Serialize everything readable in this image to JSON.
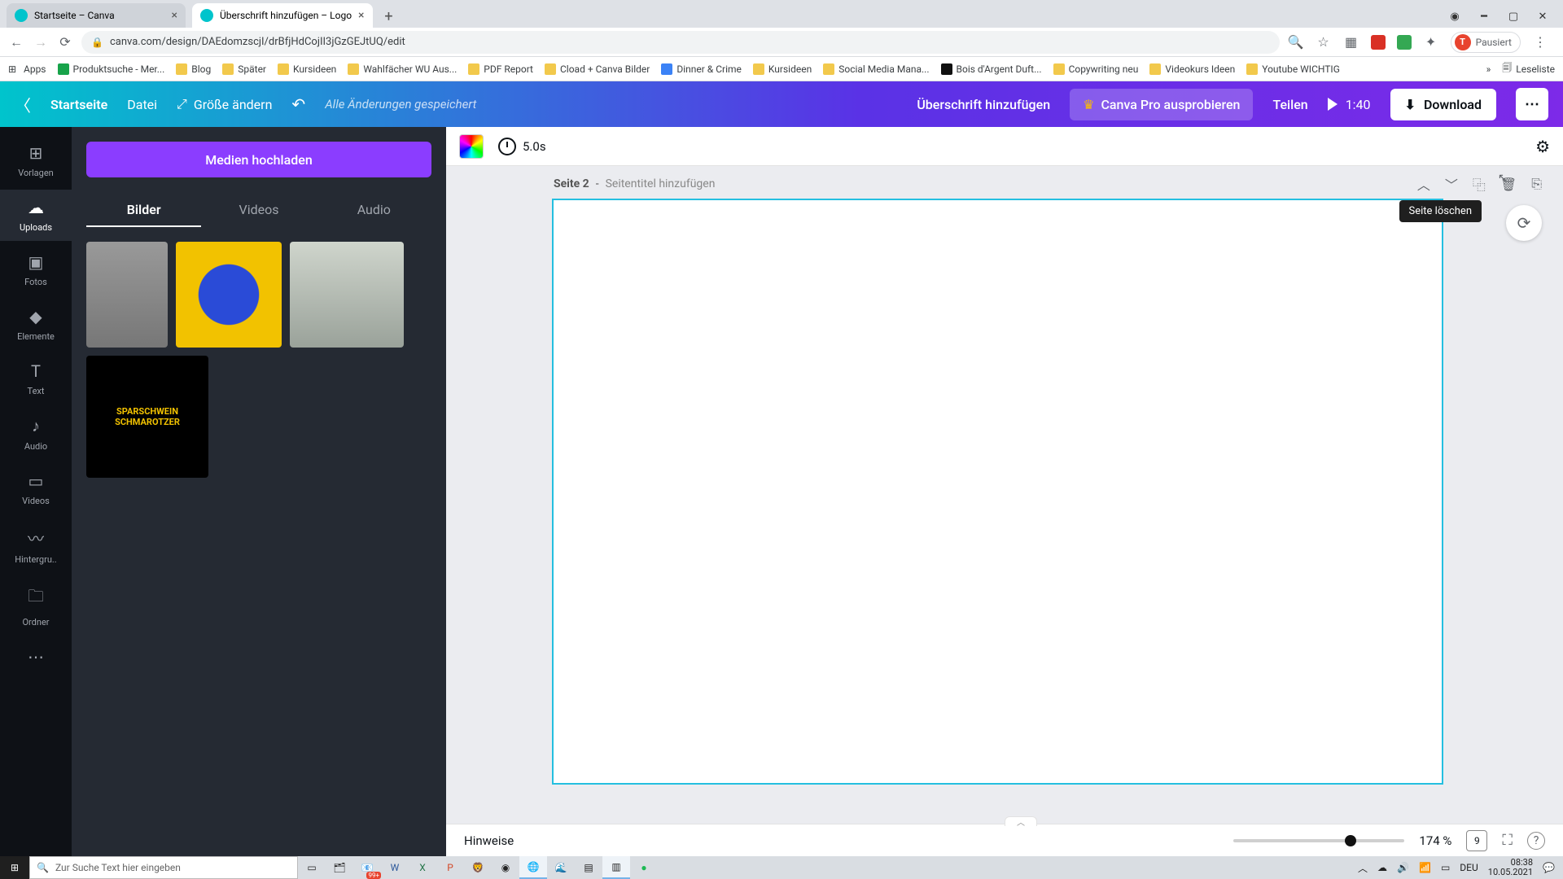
{
  "browser": {
    "tabs": [
      {
        "title": "Startseite – Canva",
        "active": false
      },
      {
        "title": "Überschrift hinzufügen – Logo",
        "active": true
      }
    ],
    "url": "canva.com/design/DAEdomzscjI/drBfjHdCojII3jGzGEJtUQ/edit",
    "profile_label": "Pausiert",
    "profile_initial": "T",
    "bookmarks": [
      "Apps",
      "Produktsuche - Mer...",
      "Blog",
      "Später",
      "Kursideen",
      "Wahlfächer WU Aus...",
      "PDF Report",
      "Cload + Canva Bilder",
      "Dinner & Crime",
      "Kursideen",
      "Social Media Mana...",
      "Bois d'Argent Duft...",
      "Copywriting neu",
      "Videokurs Ideen",
      "Youtube WICHTIG"
    ],
    "reading_list": "Leseliste"
  },
  "canva_header": {
    "home": "Startseite",
    "file": "Datei",
    "resize": "Größe ändern",
    "status": "Alle Änderungen gespeichert",
    "title": "Überschrift hinzufügen",
    "pro": "Canva Pro ausprobieren",
    "share": "Teilen",
    "play_time": "1:40",
    "download": "Download"
  },
  "rail": {
    "items": [
      {
        "label": "Vorlagen",
        "icon": "⊞"
      },
      {
        "label": "Uploads",
        "icon": "☁",
        "active": true
      },
      {
        "label": "Fotos",
        "icon": "▣"
      },
      {
        "label": "Elemente",
        "icon": "◆"
      },
      {
        "label": "Text",
        "icon": "T"
      },
      {
        "label": "Audio",
        "icon": "♪"
      },
      {
        "label": "Videos",
        "icon": "▭"
      },
      {
        "label": "Hintergru..",
        "icon": "〰"
      },
      {
        "label": "Ordner",
        "icon": "🗀"
      },
      {
        "label": "",
        "icon": "⋯"
      }
    ]
  },
  "panel": {
    "upload": "Medien hochladen",
    "tabs": [
      "Bilder",
      "Videos",
      "Audio"
    ],
    "active_tab": 0
  },
  "context_bar": {
    "duration": "5.0s"
  },
  "page": {
    "label_prefix": "Seite 2",
    "label_sep": " - ",
    "title_placeholder": "Seitentitel hinzufügen",
    "tooltip_delete": "Seite löschen"
  },
  "footer": {
    "notes": "Hinweise",
    "zoom": "174 %",
    "pages": "9"
  },
  "taskbar": {
    "search_placeholder": "Zur Suche Text hier eingeben",
    "lang": "DEU",
    "time": "08:38",
    "date": "10.05.2021",
    "badge": "99+"
  }
}
